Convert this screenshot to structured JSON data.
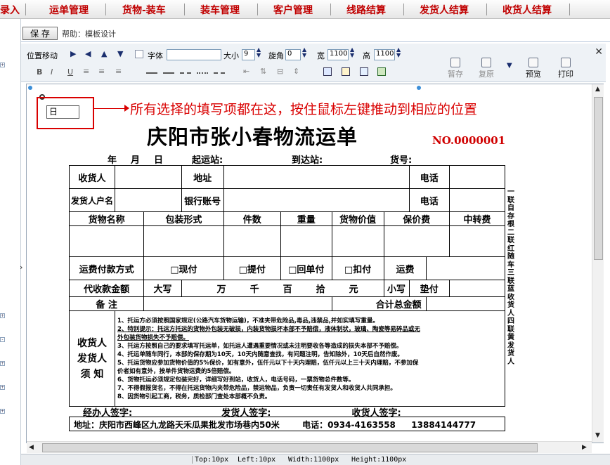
{
  "nav": {
    "items": [
      "录入",
      "运单管理",
      "货物-装车",
      "装车管理",
      "客户管理",
      "线路结算",
      "发货人结算",
      "收货人结算"
    ]
  },
  "topbar": {
    "save_label": "保 存",
    "help_text": "帮助：模板设计"
  },
  "toolbar": {
    "position_move": "位置移动",
    "font_label": "字体",
    "size_label": "大小",
    "size_value": "9",
    "rotate_label": "旋角",
    "rotate_value": "0",
    "width_label": "宽",
    "width_value": "1100",
    "height_label": "高",
    "height_value": "1100",
    "save_tpl": "暂存",
    "restore": "复原",
    "preview": "预览",
    "print": "打印"
  },
  "annotation": "所有选择的填写项都在这，按住鼠标左键推动到相应的位置",
  "date_field": "日",
  "form": {
    "title": "庆阳市张小春物流运单",
    "number": "NO.0000001",
    "header_line": {
      "year": "年",
      "month": "月",
      "day": "日",
      "origin": "起运站:",
      "dest": "到达站:",
      "goods_no": "货号:"
    },
    "rows": {
      "receiver": "收货人",
      "address": "地址",
      "phone": "电话",
      "shipper": "发货人户名",
      "bank": "银行账号",
      "cols": [
        "货物名称",
        "包装形式",
        "件数",
        "重量",
        "货物价值",
        "保价费",
        "中转费"
      ],
      "payment_method": "运费付款方式",
      "payment_options": [
        "□现付",
        "□提付",
        "□回单付",
        "□扣付"
      ],
      "freight": "运费",
      "cod": "代收款金额",
      "daxie": "大写",
      "units": [
        "万",
        "千",
        "百",
        "拾",
        "元"
      ],
      "xiaoxie": "小写",
      "advance": "垫付",
      "remarks": "备    注",
      "total": "合计总金额",
      "notice_label_lines": [
        "收货人",
        "发货人",
        "须    知"
      ]
    },
    "notice": [
      "1、托运方必须按照国家规定(公路汽车货物运输)，不准夹带危险品,毒品,违禁品,并如实填写重量。",
      "2、特别提示：托运方托运的货物外包装无破损，内装货物损坏本部不予赔偿，液体制状，玻璃、陶瓷等易碎品或无",
      "    外包装货物损失不予赔偿。",
      "3、托运方按照自己的要求填写托运单，如托运人遭遇重要情况或未注明要收各等造成的损失本部不予赔偿。",
      "4、托运单随车同行，本部的保存期为10天，10天内随意查找，有问题注明，告知除外，10天后自然作废。",
      "5、托运货物应参加货物价值的5%保价，如有意外，伍仟元以下十天内理赔，伍仟元以上三十天内理赔，不参加保",
      "    价者如有意外，按单件货物运费的5倍赔偿。",
      "6、货物托运必须规定包装完好，详细写好到站，收货人，电话号码，一票货物总件数等。",
      "7、不得假报货名，不得在托运货物内夹带危险品，禁运物品，负责一切责任有发货人和收货人共同承担。",
      "8、因货物引起工商，税务，质检部门查处本部概不负责。"
    ],
    "copies": "一联自存根 二联红随车 三联蓝收货人 四联黄发货人",
    "sign": {
      "agent": "经办人签字:",
      "shipper": "发货人签字:",
      "receiver": "收货人签字:"
    },
    "address_line": "地址：庆阳市西峰区九龙路天禾瓜果批发市场巷内50米",
    "phone_line": "电话：0934-4163558",
    "mobile": "13884144777"
  },
  "status": {
    "top": "Top:10px",
    "left": "Left:10px",
    "width": "Width:1100px",
    "height": "Height:1100px"
  }
}
